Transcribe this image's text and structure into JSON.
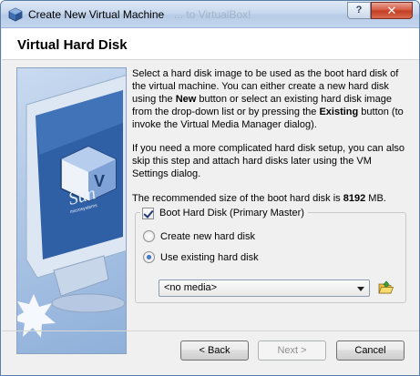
{
  "window": {
    "title": "Create New Virtual Machine",
    "title_ghost": "... to VirtualBox!",
    "help_label": "?",
    "close_label": "✕"
  },
  "page": {
    "title": "Virtual Hard Disk",
    "p1_a": "Select a hard disk image to be used as the boot hard disk of the virtual machine. You can either create a new hard disk using the ",
    "p1_new": "New",
    "p1_b": " button or select an existing hard disk image from the drop-down list or by pressing the ",
    "p1_existing": "Existing",
    "p1_c": " button (to invoke the Virtual Media Manager dialog).",
    "p2": "If you need a more complicated hard disk setup, you can also skip this step and attach hard disks later using the VM Settings dialog.",
    "p3_a": "The recommended size of the boot hard disk is ",
    "p3_size": "8192",
    "p3_unit": " MB."
  },
  "boot_disk": {
    "label": "Boot Hard Disk (Primary Master)",
    "checked": true,
    "options": [
      {
        "label": "Create new hard disk",
        "selected": false
      },
      {
        "label": "Use existing hard disk",
        "selected": true
      }
    ],
    "combo_value": "<no media>"
  },
  "side_image": {
    "logo_text": "Sun",
    "logo_sub": "microsystems"
  },
  "buttons": {
    "back": "< Back",
    "next": "Next >",
    "cancel": "Cancel"
  },
  "icons": {
    "app": "virtualbox-icon",
    "folder": "folder-open-icon"
  },
  "colors": {
    "accent": "#1d4fa8",
    "close": "#c23c22"
  }
}
